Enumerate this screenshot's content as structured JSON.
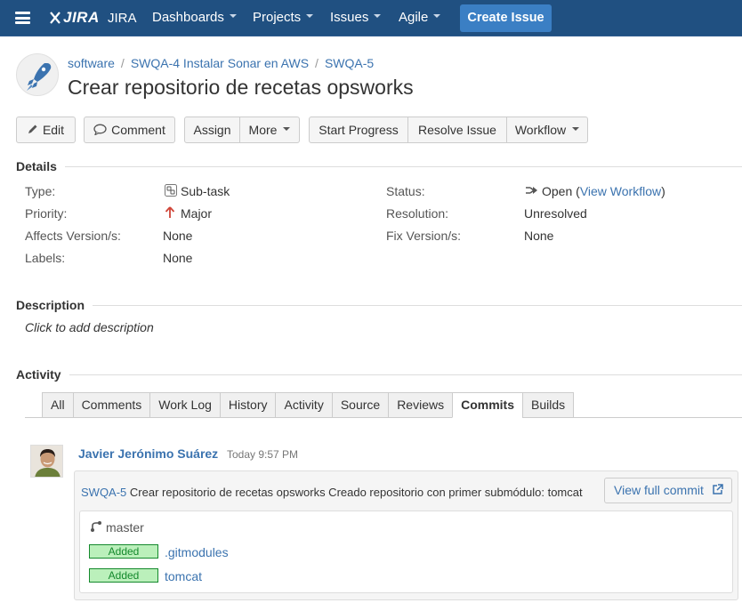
{
  "topnav": {
    "logo_mark": "JIRA",
    "app_name": "JIRA",
    "menu": [
      {
        "label": "Dashboards"
      },
      {
        "label": "Projects"
      },
      {
        "label": "Issues"
      },
      {
        "label": "Agile"
      }
    ],
    "create_label": "Create Issue",
    "bar_color": "#205081"
  },
  "header": {
    "breadcrumb": [
      "software",
      "SWQA-4 Instalar Sonar en AWS",
      "SWQA-5"
    ],
    "title": "Crear repositorio de recetas opsworks"
  },
  "toolbar": {
    "edit": "Edit",
    "comment": "Comment",
    "assign": "Assign",
    "more": "More",
    "start_progress": "Start Progress",
    "resolve_issue": "Resolve Issue",
    "workflow": "Workflow"
  },
  "details": {
    "heading": "Details",
    "type": {
      "label": "Type:",
      "value": "Sub-task"
    },
    "priority": {
      "label": "Priority:",
      "value": "Major"
    },
    "affects": {
      "label": "Affects Version/s:",
      "value": "None"
    },
    "labels": {
      "label": "Labels:",
      "value": "None"
    },
    "status": {
      "label": "Status:",
      "value": "Open",
      "paren_open": "(",
      "link": "View Workflow",
      "paren_close": ")"
    },
    "resolution": {
      "label": "Resolution:",
      "value": "Unresolved"
    },
    "fix": {
      "label": "Fix Version/s:",
      "value": "None"
    }
  },
  "description": {
    "heading": "Description",
    "placeholder": "Click to add description"
  },
  "activity": {
    "heading": "Activity",
    "tabs": [
      "All",
      "Comments",
      "Work Log",
      "History",
      "Activity",
      "Source",
      "Reviews",
      "Commits",
      "Builds"
    ],
    "active_tab": "Commits"
  },
  "commit": {
    "author": "Javier Jerónimo Suárez",
    "time": "Today 9:57 PM",
    "issue_key": "SWQA-5",
    "message": "Crear repositorio de recetas opsworks Creado repositorio con primer submódulo: tomcat",
    "view_full": "View full commit",
    "branch": "master",
    "files": [
      {
        "status": "Added",
        "name": ".gitmodules"
      },
      {
        "status": "Added",
        "name": "tomcat"
      }
    ]
  }
}
